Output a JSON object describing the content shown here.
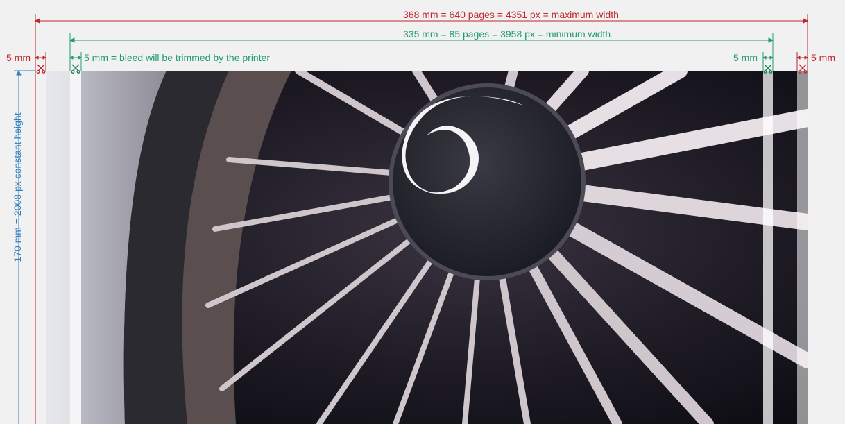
{
  "dimensions": {
    "max_width_label": "368 mm = 640 pages = 4351 px = maximum width",
    "min_width_label": "335 mm = 85 pages = 3958 px = minimum width",
    "bleed_left_outer": "5 mm",
    "bleed_note": "5 mm = bleed will be trimmed by the printer",
    "bleed_right_inner": "5 mm",
    "bleed_right_outer": "5 mm",
    "height_label": "170 mm = 2008 px constant height"
  },
  "colors": {
    "max_width": "#c1272d",
    "min_width": "#1f9e6e",
    "height": "#2f7fc1",
    "hub": "#2a2a33",
    "spiral": "#f4f4f6"
  },
  "icons": [
    "scissors-icon"
  ]
}
